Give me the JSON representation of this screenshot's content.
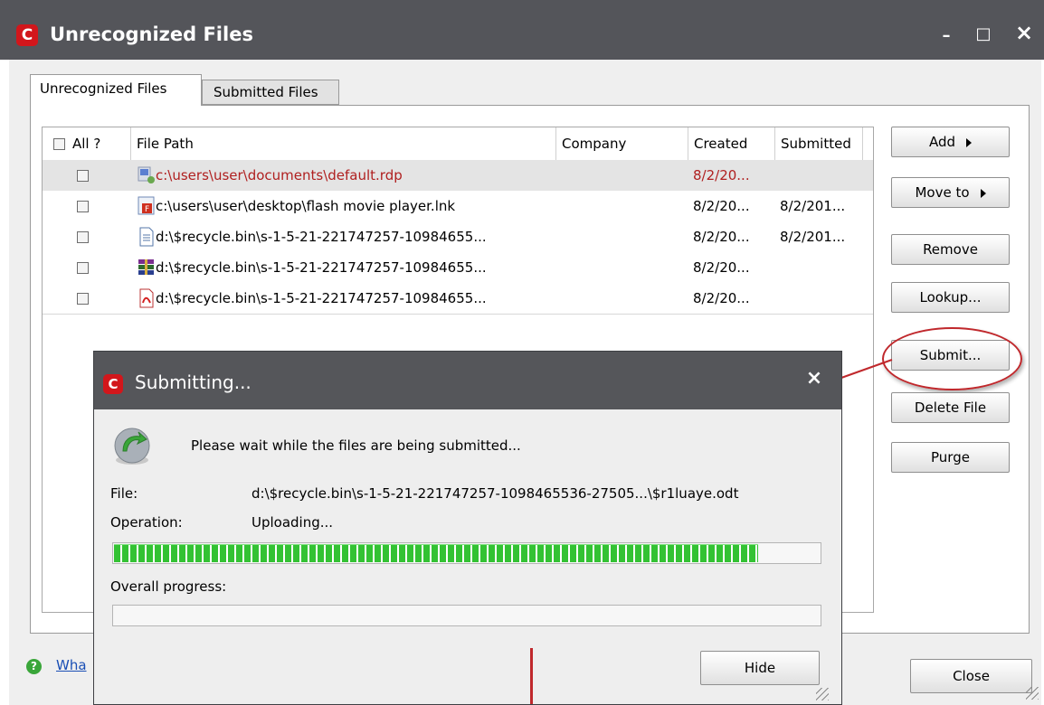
{
  "window": {
    "title": "Unrecognized Files",
    "controls": {
      "minimize": "–",
      "maximize": "□",
      "close": "×"
    }
  },
  "tabs": [
    {
      "label": "Unrecognized Files",
      "active": true
    },
    {
      "label": "Submitted Files",
      "active": false
    }
  ],
  "table": {
    "columns": {
      "all": "All ?",
      "file_path": "File Path",
      "company": "Company",
      "created": "Created",
      "submitted": "Submitted"
    },
    "rows": [
      {
        "file_path": "c:\\users\\user\\documents\\default.rdp",
        "company": "",
        "created": "8/2/20...",
        "submitted": "",
        "icon": "rdp-file-icon",
        "selected": true,
        "highlight": true
      },
      {
        "file_path": "c:\\users\\user\\desktop\\flash movie player.lnk",
        "company": "",
        "created": "8/2/20...",
        "submitted": "8/2/201...",
        "icon": "flash-file-icon"
      },
      {
        "file_path": "d:\\$recycle.bin\\s-1-5-21-221747257-10984655...",
        "company": "",
        "created": "8/2/20...",
        "submitted": "8/2/201...",
        "icon": "text-document-icon"
      },
      {
        "file_path": "d:\\$recycle.bin\\s-1-5-21-221747257-10984655...",
        "company": "",
        "created": "8/2/20...",
        "submitted": "",
        "icon": "archive-icon"
      },
      {
        "file_path": "d:\\$recycle.bin\\s-1-5-21-221747257-10984655...",
        "company": "",
        "created": "8/2/20...",
        "submitted": "",
        "icon": "pdf-icon"
      }
    ]
  },
  "side_buttons": {
    "add": "Add",
    "move_to": "Move to",
    "remove": "Remove",
    "lookup": "Lookup...",
    "submit": "Submit...",
    "delete_file": "Delete File",
    "purge": "Purge"
  },
  "footer": {
    "help_link": "Wha",
    "close": "Close"
  },
  "dialog": {
    "title": "Submitting...",
    "close": "×",
    "message": "Please wait while the files are being submitted...",
    "file_label": "File:",
    "file_value": "d:\\$recycle.bin\\s-1-5-21-221747257-1098465536-27505...\\$r1luaye.odt",
    "operation_label": "Operation:",
    "operation_value": "Uploading...",
    "upload_progress": 0.91,
    "overall_label": "Overall progress:",
    "overall_progress": 0,
    "hide_button": "Hide"
  },
  "colors": {
    "accent_red": "#d2161b",
    "highlight_text": "#b02020",
    "progress_green": "#33c233",
    "titlebar": "#54555a"
  }
}
